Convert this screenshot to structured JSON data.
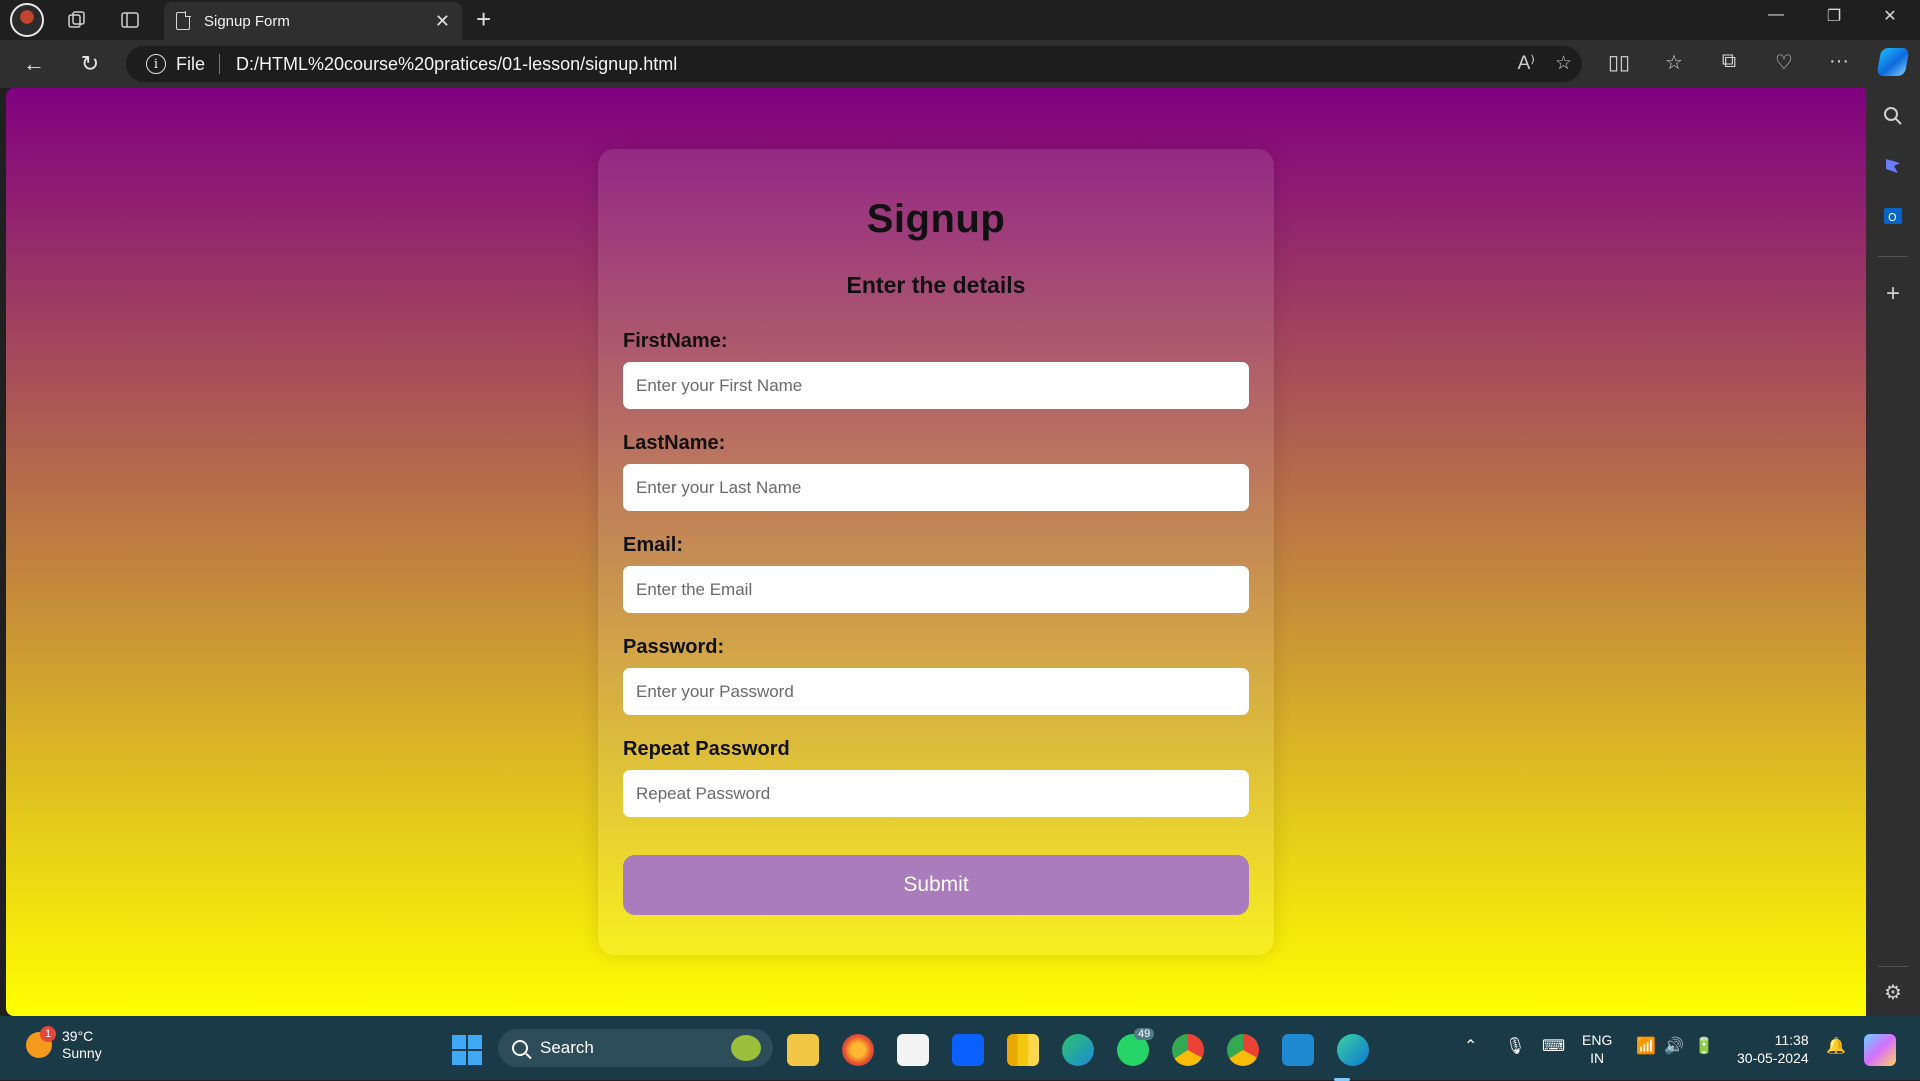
{
  "browser": {
    "tab_title": "Signup Form",
    "address": {
      "scheme_label": "File",
      "url": "D:/HTML%20course%20pratices/01-lesson/signup.html"
    }
  },
  "form": {
    "title": "Signup",
    "subtitle": "Enter the details",
    "fields": [
      {
        "label": "FirstName:",
        "placeholder": "Enter your First Name",
        "value": ""
      },
      {
        "label": "LastName:",
        "placeholder": "Enter your Last Name",
        "value": ""
      },
      {
        "label": "Email:",
        "placeholder": "Enter the Email",
        "value": ""
      },
      {
        "label": "Password:",
        "placeholder": "Enter your Password",
        "value": ""
      },
      {
        "label": "Repeat Password",
        "placeholder": "Repeat Password",
        "value": ""
      }
    ],
    "submit_label": "Submit"
  },
  "taskbar": {
    "weather": {
      "temp": "39°C",
      "condition": "Sunny",
      "badge": "1"
    },
    "search_label": "Search",
    "whatsapp_badge": "49",
    "language": {
      "line1": "ENG",
      "line2": "IN"
    },
    "clock": {
      "time": "11:38",
      "date": "30-05-2024"
    }
  },
  "colors": {
    "gradient_top": "#800080",
    "gradient_bottom": "#ffff00",
    "submit_bg": "#ab7cbb"
  }
}
